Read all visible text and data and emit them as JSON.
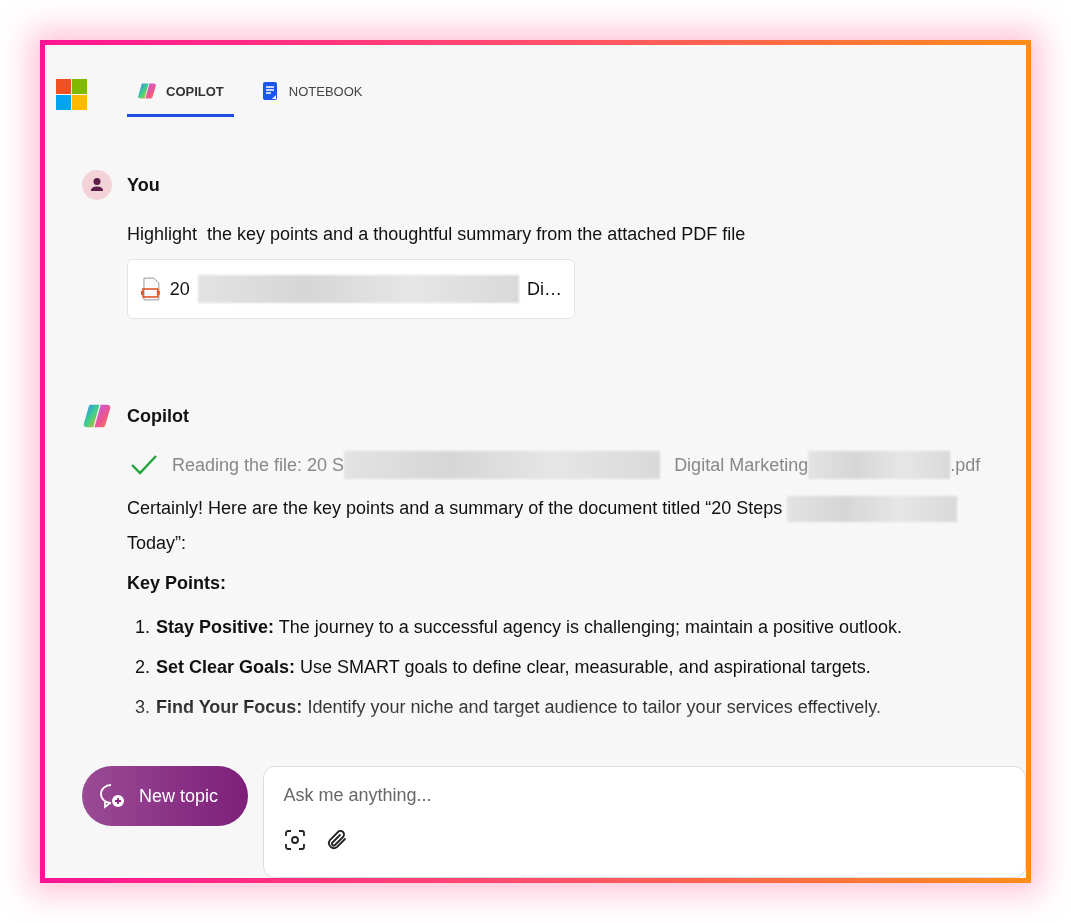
{
  "tabs": [
    {
      "label": "COPILOT",
      "selected": true
    },
    {
      "label": "NOTEBOOK",
      "selected": false
    }
  ],
  "user_message": {
    "author": "You",
    "text": "Highlight  the key points and a thoughtful summary from the attached PDF file",
    "attachment": {
      "name_start": "20",
      "name_end": "Di…"
    }
  },
  "copilot_message": {
    "author": "Copilot",
    "status": {
      "done": true,
      "prefix": "Reading the file: 20 S",
      "middle": "Digital Marketing",
      "suffix": ".pdf"
    },
    "intro_start": "Certainly! Here are the key points and a summary of the document titled “20 Steps",
    "intro_end": "Today”:",
    "heading": "Key Points:",
    "points": [
      {
        "number": "1.",
        "title": "Stay Positive:",
        "text": "The journey to a successful agency is challenging; maintain a positive outlook."
      },
      {
        "number": "2.",
        "title": "Set Clear Goals:",
        "text": "Use SMART goals to define clear, measurable, and aspirational targets."
      },
      {
        "number": "3.",
        "title": "Find Your Focus:",
        "text": "Identify your niche and target audience to tailor your services effectively."
      }
    ]
  },
  "new_topic_button": "New topic",
  "input": {
    "placeholder": "Ask me anything..."
  }
}
